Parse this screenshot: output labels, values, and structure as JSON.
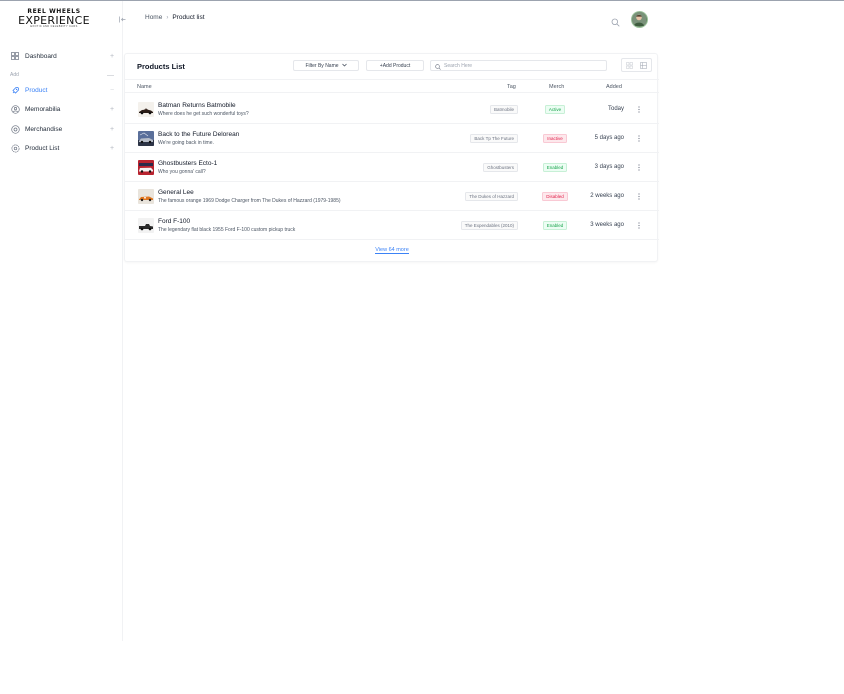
{
  "brand": {
    "line1": "REEL WHEELS",
    "line2": "EXPERIENCE",
    "line3": "EXOTIC AND CELEBRITY CARS"
  },
  "sidebar": {
    "items": [
      {
        "label": "Dashboard",
        "icon": "grid-icon"
      },
      {
        "label": "Product",
        "icon": "rocket-icon",
        "active": true
      },
      {
        "label": "Memorabilia",
        "icon": "user-circle-icon"
      },
      {
        "label": "Merchandise",
        "icon": "settings-icon"
      },
      {
        "label": "Product List",
        "icon": "cog-outline-icon"
      }
    ],
    "section_label": "Add"
  },
  "header": {
    "breadcrumb_home": "Home",
    "breadcrumb_current": "Product list"
  },
  "products": {
    "title": "Products List",
    "filter_label": "Filter By Name",
    "add_label": "+Add Product",
    "search_placeholder": "Search Here",
    "columns": {
      "name": "Name",
      "tag": "Tag",
      "merch": "Merch",
      "added": "Added"
    },
    "rows": [
      {
        "name": "Batman Returns Batmobile",
        "desc": "Where does he get such wonderful toys?",
        "tag": "Batmobile",
        "merch": "Active",
        "added": "Today"
      },
      {
        "name": "Back to the Future Delorean",
        "desc": "We're going back in time.",
        "tag": "Back Tp The Future",
        "merch": "Inactive",
        "added": "5 days ago"
      },
      {
        "name": "Ghostbusters Ecto-1",
        "desc": "Who you gonna' call?",
        "tag": "Ghostbusters",
        "merch": "Enabled",
        "added": "3 days ago"
      },
      {
        "name": "General Lee",
        "desc": "The famous orange 1969 Dodge Charger from The Dukes of Hazzard (1979-1985)",
        "tag": "The Dukes of Hazzard",
        "merch": "Disabled",
        "added": "2 weeks ago"
      },
      {
        "name": "Ford F-100",
        "desc": "The legendary flat black 1955 Ford F-100 custom pickup truck",
        "tag": "The Expendables (2010)",
        "merch": "Enabled",
        "added": "3 weeks ago"
      }
    ],
    "view_more": "View 64 more"
  },
  "colors": {
    "accent": "#3b82f6",
    "success_bg": "#ecfdf3",
    "success_fg": "#16a34a",
    "danger_bg": "#fde8ec",
    "danger_fg": "#e11d48"
  }
}
